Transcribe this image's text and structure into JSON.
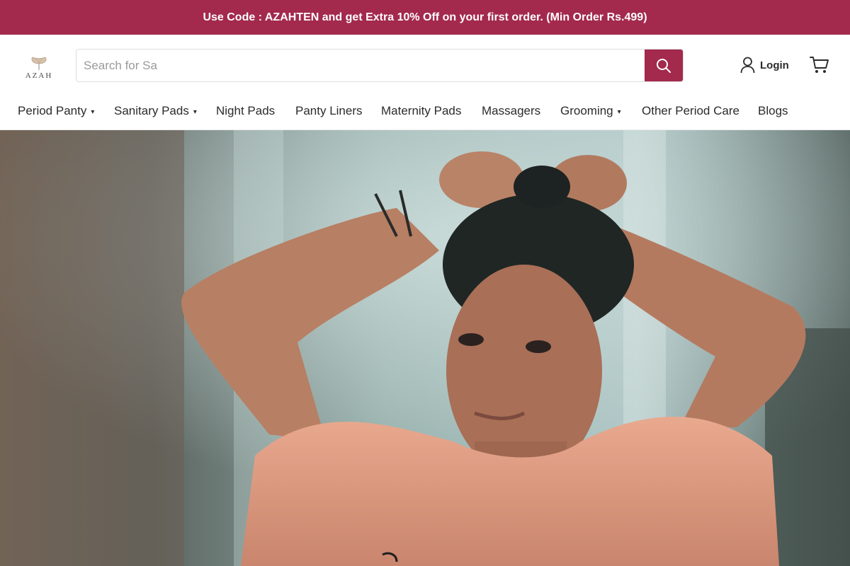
{
  "announcement": {
    "text": "Use Code : AZAHTEN and get Extra 10% Off on your first order. (Min Order Rs.499)",
    "background": "#a3294d"
  },
  "brand": {
    "logo_text": "AZAH"
  },
  "search": {
    "placeholder": "Search for Sa",
    "value": "",
    "button_icon": "search-icon",
    "button_color": "#a3294d"
  },
  "account": {
    "login_label": "Login",
    "login_icon": "user-icon",
    "cart_icon": "cart-icon"
  },
  "nav": {
    "items": [
      {
        "label": "Period Panty",
        "has_dropdown": true
      },
      {
        "label": "Sanitary Pads",
        "has_dropdown": true
      },
      {
        "label": "Night Pads",
        "has_dropdown": false
      },
      {
        "label": "Panty Liners",
        "has_dropdown": false
      },
      {
        "label": "Maternity Pads",
        "has_dropdown": false
      },
      {
        "label": "Massagers",
        "has_dropdown": false
      },
      {
        "label": "Grooming",
        "has_dropdown": true
      },
      {
        "label": "Other Period Care",
        "has_dropdown": false
      },
      {
        "label": "Blogs",
        "has_dropdown": false
      }
    ]
  },
  "colors": {
    "accent": "#a3294d",
    "text": "#2b2b2b"
  }
}
